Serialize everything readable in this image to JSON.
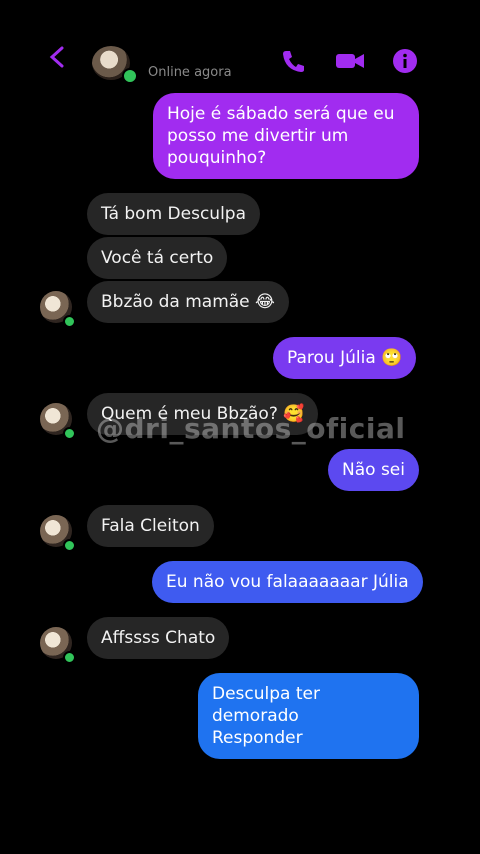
{
  "header": {
    "status_text": "Online agora",
    "icons": [
      "back-arrow-icon",
      "phone-icon",
      "video-camera-icon",
      "info-icon"
    ],
    "accent_color": "#a12cf0"
  },
  "watermark": "@dri_santos_oficial",
  "messages": [
    {
      "sender": "me",
      "text": "Hoje é sábado será que eu\nposso me divertir um\npouquinho?",
      "color": "#a12cf0"
    },
    {
      "sender": "contact",
      "text": "Tá bom Desculpa"
    },
    {
      "sender": "contact",
      "text": "Você tá certo"
    },
    {
      "sender": "contact",
      "text": "Bbzão da mamãe 😂"
    },
    {
      "sender": "me",
      "text": "Parou Júlia 🙄",
      "color": "#7a3af0"
    },
    {
      "sender": "contact",
      "text": "Quem é meu Bbzão? 🥰"
    },
    {
      "sender": "me",
      "text": "Não sei",
      "color": "#5c49f0"
    },
    {
      "sender": "contact",
      "text": "Fala Cleiton"
    },
    {
      "sender": "me",
      "text": "Eu não vou falaaaaaaar Júlia",
      "color": "#3f5bf0"
    },
    {
      "sender": "contact",
      "text": "Affssss Chato"
    },
    {
      "sender": "me",
      "text": "Desculpa ter demorado\nResponder",
      "color": "#1f73f0"
    }
  ]
}
